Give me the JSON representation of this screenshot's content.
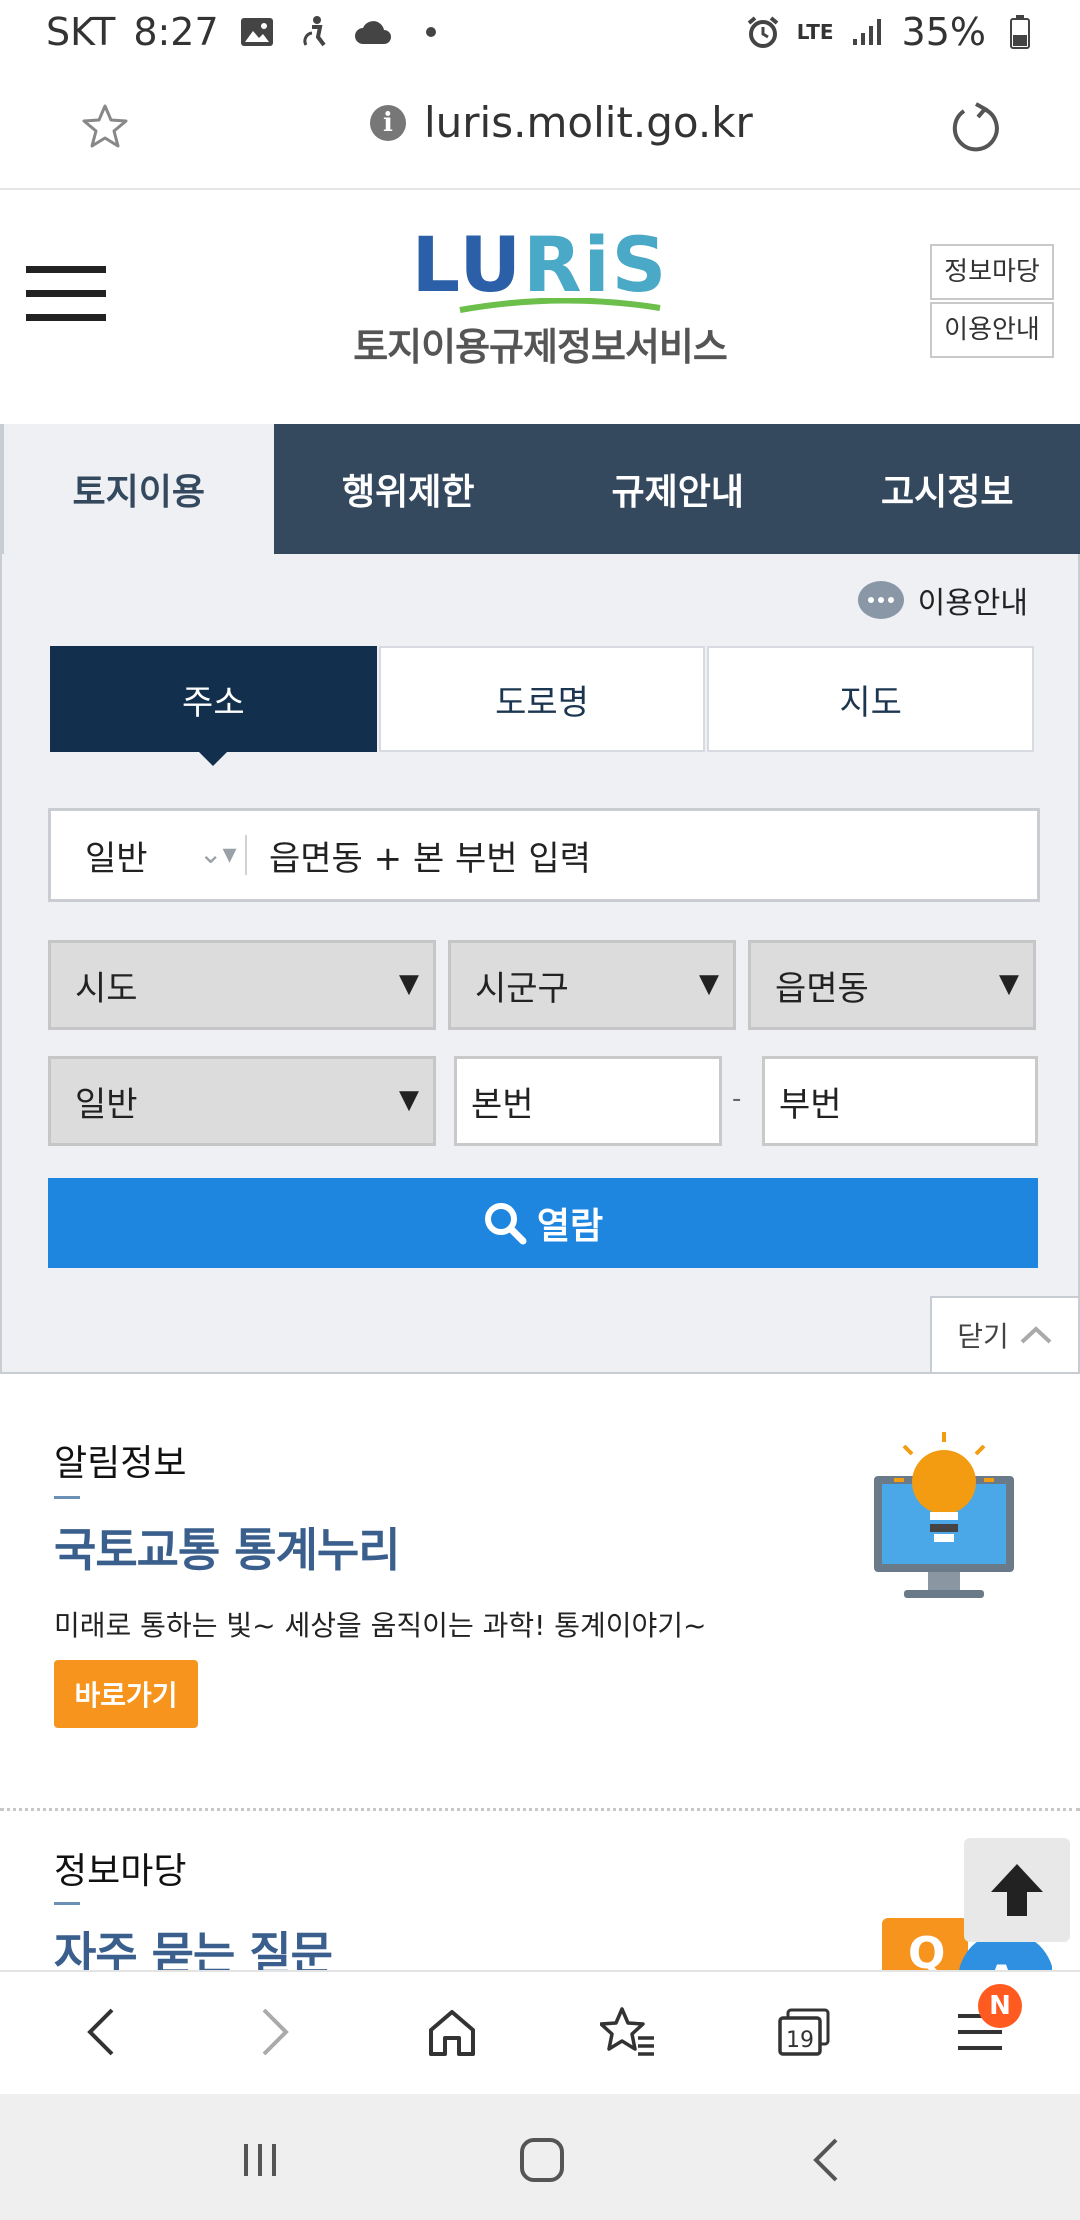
{
  "status_bar": {
    "carrier": "SKT",
    "time": "8:27",
    "network": "LTE",
    "battery": "35%"
  },
  "address_bar": {
    "url": "luris.molit.go.kr"
  },
  "header": {
    "logo_wordmark_a": "LU",
    "logo_wordmark_b": "RiS",
    "logo_subtitle": "토지이용규제정보서비스",
    "links": [
      "정보마당",
      "이용안내"
    ]
  },
  "search_panel": {
    "main_tabs": [
      "토지이용",
      "행위제한",
      "규제안내",
      "고시정보"
    ],
    "active_main_tab": "토지이용",
    "guide_label": "이용안내",
    "sub_tabs": [
      "주소",
      "도로명",
      "지도"
    ],
    "active_sub_tab": "주소",
    "search_type_value": "일반",
    "search_placeholder": "읍면동 + 본 부번 입력",
    "select_sido": "시도",
    "select_sigungu": "시군구",
    "select_eupmyeondong": "읍면동",
    "select_type": "일반",
    "main_number_placeholder": "본번",
    "dash": "-",
    "sub_number_placeholder": "부번",
    "view_button": "열람",
    "close_button": "닫기"
  },
  "notice": {
    "label": "알림정보",
    "title": "국토교통 통계누리",
    "description": "미래로 통하는 빛~ 세상을 움직이는 과학! 통계이야기~",
    "button": "바로가기"
  },
  "faq": {
    "label": "정보마당",
    "title": "자주 묻는 질문"
  },
  "browser_nav": {
    "tabs_count": "19",
    "menu_badge": "N"
  },
  "colors": {
    "tab_bar": "#34495e",
    "active_subtab": "#12304d",
    "view_button": "#1f86e0",
    "goto_button": "#f7941d",
    "title_blue": "#3a5f8c"
  }
}
